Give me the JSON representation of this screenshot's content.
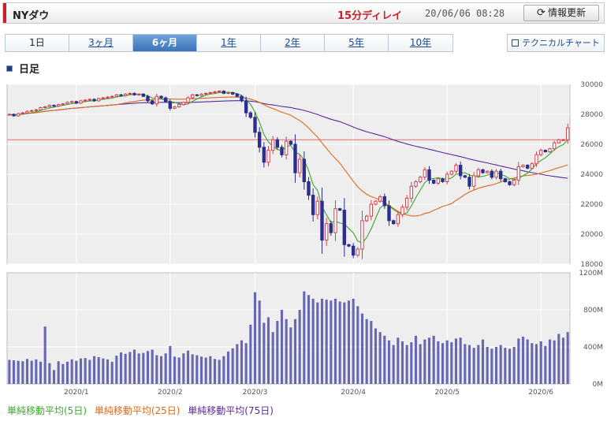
{
  "header": {
    "title": "NYダウ",
    "delay_label": "15分ディレイ",
    "timestamp": "20/06/06 08:28",
    "refresh_label": "情報更新",
    "refresh_icon": "refresh-icon",
    "accent_color": "#c7232b"
  },
  "tabs": [
    {
      "label": "1日",
      "active": false
    },
    {
      "label": "3ヶ月",
      "active": false
    },
    {
      "label": "6ヶ月",
      "active": true
    },
    {
      "label": "1年",
      "active": false
    },
    {
      "label": "2年",
      "active": false
    },
    {
      "label": "5年",
      "active": false
    },
    {
      "label": "10年",
      "active": false
    }
  ],
  "technical_chart_label": "テクニカルチャート",
  "section_title": "日足",
  "legend": [
    {
      "label": "単純移動平均(5日)",
      "color": "#3aa82c"
    },
    {
      "label": "単純移動平均(25日)",
      "color": "#e06a1a"
    },
    {
      "label": "単純移動平均(75日)",
      "color": "#5a2a9a"
    }
  ],
  "chart_data": {
    "type": "candlestick",
    "price_ylim": [
      18000,
      30000
    ],
    "price_ticks": [
      "30000",
      "28000",
      "26000",
      "24000",
      "22000",
      "20000",
      "18000"
    ],
    "volume_ylim": [
      0,
      1200
    ],
    "volume_ticks": [
      "1200M",
      "800M",
      "400M",
      "0M"
    ],
    "x_tick_labels": [
      {
        "label": "2020/1",
        "index": 15
      },
      {
        "label": "2020/2",
        "index": 36
      },
      {
        "label": "2020/3",
        "index": 55
      },
      {
        "label": "2020/4",
        "index": 77
      },
      {
        "label": "2020/5",
        "index": 98
      },
      {
        "label": "2020/6",
        "index": 119
      }
    ],
    "reference_line": 26300,
    "reference_color": "#e07070",
    "up_color": "#d3434f",
    "down_color": "#2b2f8f",
    "volume_color": "#6868b0",
    "closes": [
      28000,
      27900,
      28050,
      28100,
      28200,
      28250,
      28300,
      28450,
      28500,
      28600,
      28550,
      28650,
      28700,
      28800,
      28850,
      28750,
      28900,
      28950,
      29000,
      28900,
      29050,
      29100,
      29150,
      29200,
      29300,
      29250,
      29350,
      29400,
      29300,
      29350,
      29200,
      28900,
      28700,
      29200,
      29100,
      28850,
      28400,
      28500,
      28650,
      28800,
      29100,
      29300,
      29250,
      29350,
      29400,
      29450,
      29500,
      29550,
      29400,
      29450,
      29350,
      29200,
      28900,
      28100,
      27800,
      26800,
      25800,
      24800,
      25600,
      26300,
      25800,
      25300,
      26200,
      26000,
      24100,
      25000,
      23500,
      22600,
      21300,
      22200,
      19600,
      20700,
      20100,
      21700,
      21600,
      19300,
      19200,
      18600,
      19000,
      20900,
      21200,
      22000,
      22200,
      22500,
      21900,
      20900,
      20700,
      21300,
      21800,
      22400,
      23200,
      23500,
      23800,
      24300,
      23600,
      23400,
      23700,
      23500,
      24000,
      24200,
      24600,
      23900,
      23800,
      23200,
      23900,
      24300,
      24100,
      24200,
      23800,
      24200,
      23700,
      23500,
      23300,
      23600,
      24500,
      24600,
      24400,
      24700,
      25300,
      25600,
      25500,
      25700,
      26100,
      26300,
      26300,
      27100
    ],
    "volumes": [
      260,
      255,
      250,
      245,
      270,
      250,
      265,
      240,
      620,
      225,
      150,
      245,
      215,
      240,
      265,
      250,
      275,
      280,
      260,
      300,
      290,
      275,
      265,
      240,
      305,
      340,
      325,
      345,
      370,
      330,
      335,
      355,
      370,
      310,
      300,
      330,
      410,
      295,
      285,
      330,
      360,
      320,
      310,
      295,
      285,
      300,
      270,
      260,
      300,
      350,
      385,
      430,
      470,
      440,
      640,
      990,
      900,
      660,
      720,
      560,
      680,
      800,
      700,
      610,
      700,
      800,
      1000,
      960,
      920,
      880,
      920,
      910,
      900,
      920,
      890,
      880,
      900,
      920,
      840,
      760,
      700,
      680,
      600,
      560,
      520,
      470,
      420,
      500,
      460,
      420,
      450,
      520,
      430,
      480,
      500,
      520,
      460,
      440,
      470,
      450,
      490,
      500,
      430,
      420,
      390,
      420,
      480,
      400,
      380,
      400,
      420,
      390,
      380,
      400,
      490,
      510,
      480,
      440,
      430,
      460,
      410,
      480,
      470,
      540,
      500,
      560
    ]
  }
}
